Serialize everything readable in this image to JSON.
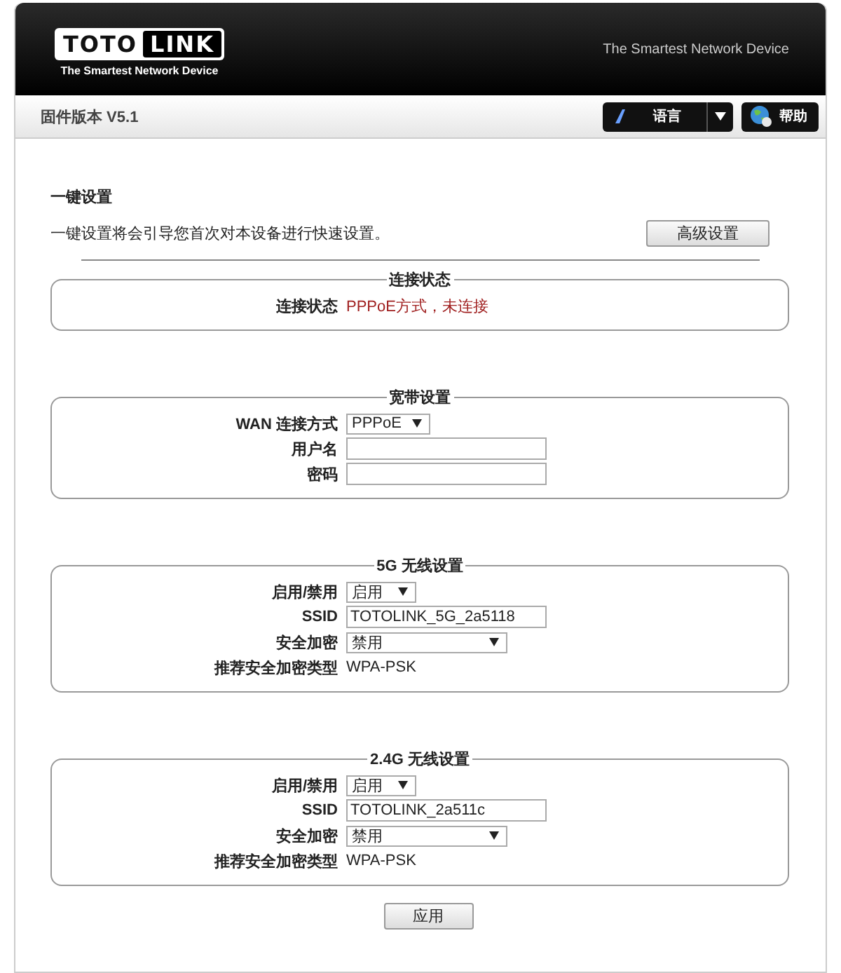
{
  "header": {
    "logo": {
      "left": "TOTO",
      "right": "LINK",
      "tagline": "The Smartest Network Device"
    },
    "slogan": "The Smartest Network Device"
  },
  "toolbar": {
    "firmware": "固件版本 V5.1",
    "language_button": "语言",
    "help_button": "帮助"
  },
  "quick_setup": {
    "title": "一键设置",
    "description": "一键设置将会引导您首次对本设备进行快速设置。",
    "advanced_button": "高级设置"
  },
  "sections": [
    {
      "title": "连接状态",
      "rows": [
        {
          "kind": "status",
          "label": "连接状态",
          "value": "PPPoE方式，未连接"
        }
      ]
    },
    {
      "title": "宽带设置",
      "rows": [
        {
          "kind": "select",
          "label": "WAN 连接方式",
          "value": "PPPoE"
        },
        {
          "kind": "input",
          "label": "用户名"
        },
        {
          "kind": "input",
          "label": "密码"
        }
      ]
    },
    {
      "title": "5G 无线设置",
      "rows": [
        {
          "kind": "select",
          "label": "启用/禁用",
          "value": "启用"
        },
        {
          "kind": "input",
          "label": "SSID",
          "value": "TOTOLINK_5G_2a5118"
        },
        {
          "kind": "wideselect",
          "label": "安全加密",
          "value": "禁用"
        },
        {
          "kind": "text",
          "label": "推荐安全加密类型",
          "value": "WPA-PSK"
        }
      ]
    },
    {
      "title": "2.4G 无线设置",
      "rows": [
        {
          "kind": "select",
          "label": "启用/禁用",
          "value": "启用"
        },
        {
          "kind": "input",
          "label": "SSID",
          "value": "TOTOLINK_2a511c"
        },
        {
          "kind": "wideselect",
          "label": "安全加密",
          "value": "禁用"
        },
        {
          "kind": "text",
          "label": "推荐安全加密类型",
          "value": "WPA-PSK"
        }
      ]
    }
  ],
  "apply_button": "应用"
}
